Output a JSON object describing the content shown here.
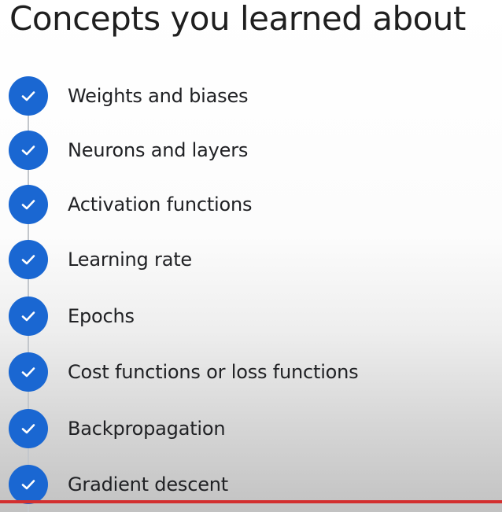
{
  "title": "Concepts you learned about",
  "items": [
    {
      "label": "Weights and biases",
      "icon": "check-circle-icon"
    },
    {
      "label": "Neurons and layers",
      "icon": "check-circle-icon"
    },
    {
      "label": "Activation functions",
      "icon": "check-circle-icon"
    },
    {
      "label": "Learning rate",
      "icon": "check-circle-icon"
    },
    {
      "label": "Epochs",
      "icon": "check-circle-icon"
    },
    {
      "label": "Cost functions or loss functions",
      "icon": "check-circle-icon"
    },
    {
      "label": "Backpropagation",
      "icon": "check-circle-icon"
    },
    {
      "label": "Gradient descent",
      "icon": "check-circle-icon"
    }
  ],
  "video_progress": 1.0,
  "colors": {
    "check_circle": "#1a67d2",
    "check_mark": "#ffffff",
    "progress_bar": "#d32f2f",
    "title_text": "#1f1f1f"
  }
}
